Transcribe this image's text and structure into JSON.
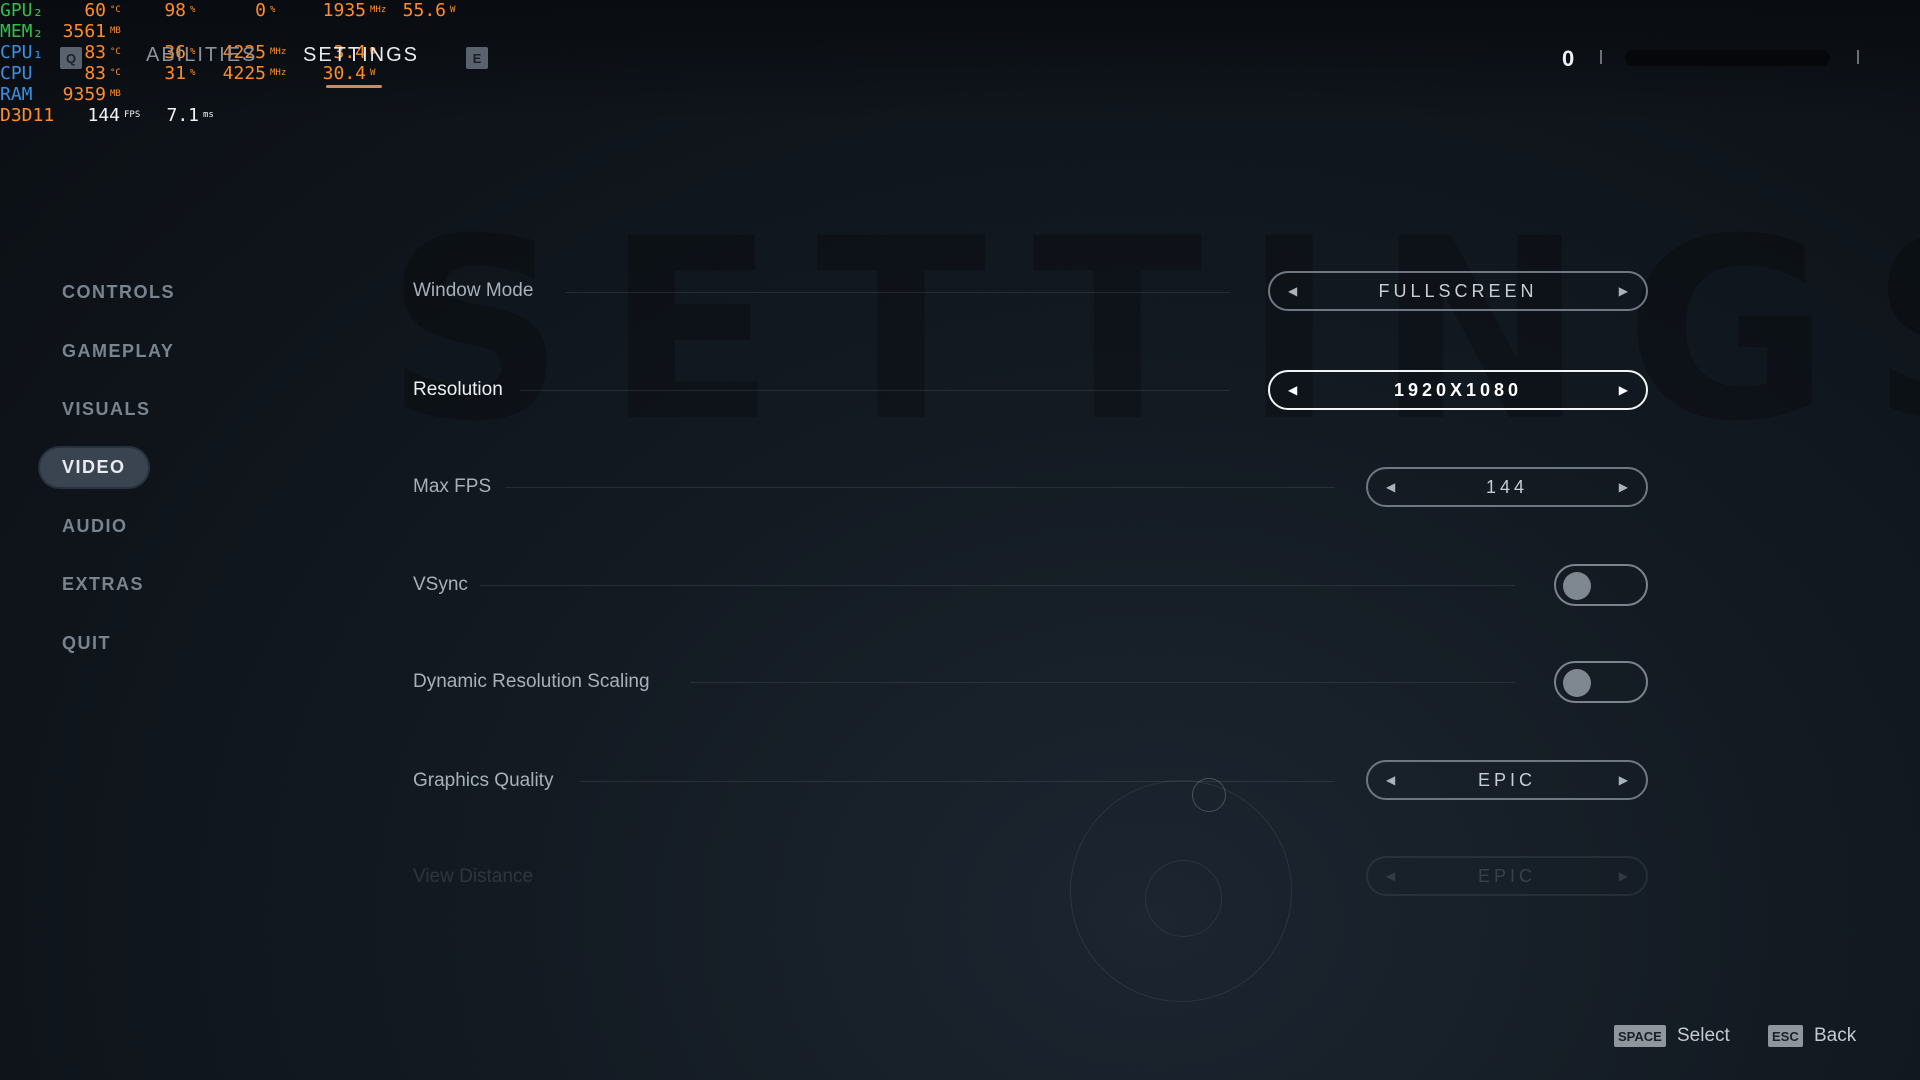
{
  "perf_overlay": [
    {
      "label": "GPU₂",
      "label_color": "#2fbf4a",
      "cells": [
        {
          "v": "60",
          "u": "°C"
        },
        {
          "v": "98",
          "u": "%"
        },
        {
          "v": "0",
          "u": "%"
        },
        {
          "v": "1935",
          "u": "MHz"
        },
        {
          "v": "55.6",
          "u": "W"
        }
      ]
    },
    {
      "label": "MEM₂",
      "label_color": "#2fbf4a",
      "cells": [
        {
          "v": "3561",
          "u": "MB"
        }
      ]
    },
    {
      "label": "CPU₁",
      "label_color": "#3a8fe0",
      "cells": [
        {
          "v": "83",
          "u": "°C"
        },
        {
          "v": "36",
          "u": "%"
        },
        {
          "v": "4225",
          "u": "MHz"
        },
        {
          "v": "3.4",
          "u": "W"
        }
      ]
    },
    {
      "label": "CPU",
      "label_color": "#3a8fe0",
      "cells": [
        {
          "v": "83",
          "u": "°C"
        },
        {
          "v": "31",
          "u": "%"
        },
        {
          "v": "4225",
          "u": "MHz"
        },
        {
          "v": "30.4",
          "u": "W"
        }
      ]
    },
    {
      "label": "RAM",
      "label_color": "#3a8fe0",
      "cells": [
        {
          "v": "9359",
          "u": "MB"
        }
      ]
    },
    {
      "label": "D3D11",
      "label_color": "#ff8c2a",
      "cells": [
        {
          "v": "144",
          "u": "FPS",
          "white": true
        },
        {
          "v": "7.1",
          "u": "ms",
          "white": true
        }
      ]
    }
  ],
  "header": {
    "q_key": "Q",
    "e_key": "E",
    "tabs": [
      {
        "label": "ABILITIES"
      },
      {
        "label": "SETTINGS"
      }
    ],
    "score": "0"
  },
  "watermark": "SETTINGS",
  "nav": [
    {
      "label": "CONTROLS"
    },
    {
      "label": "GAMEPLAY"
    },
    {
      "label": "VISUALS"
    },
    {
      "label": "VIDEO"
    },
    {
      "label": "AUDIO"
    },
    {
      "label": "EXTRAS"
    },
    {
      "label": "QUIT"
    }
  ],
  "settings": {
    "window_mode": {
      "label": "Window Mode",
      "value": "FULLSCREEN"
    },
    "resolution": {
      "label": "Resolution",
      "value": "1920X1080"
    },
    "max_fps": {
      "label": "Max FPS",
      "value": "144"
    },
    "vsync": {
      "label": "VSync",
      "value": false
    },
    "dynamic_resolution": {
      "label": "Dynamic Resolution Scaling",
      "value": false
    },
    "graphics_quality": {
      "label": "Graphics Quality",
      "value": "EPIC"
    },
    "view_distance": {
      "label": "View Distance",
      "value": "EPIC"
    }
  },
  "footer": {
    "select_key": "SPACE",
    "select_label": "Select",
    "back_key": "ESC",
    "back_label": "Back"
  }
}
